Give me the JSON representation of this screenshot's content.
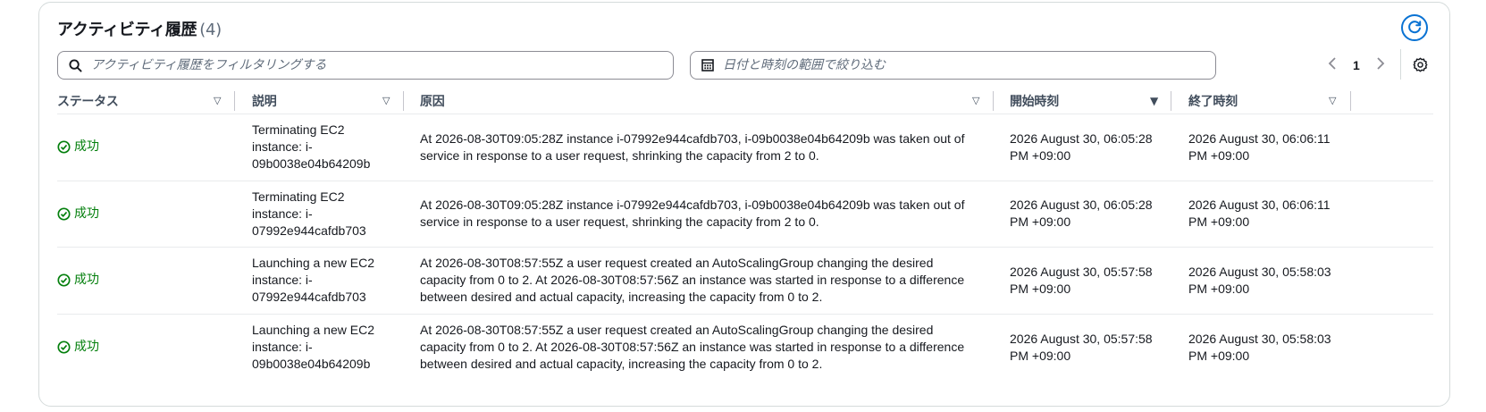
{
  "header": {
    "title": "アクティビティ履歴",
    "count": "(4)"
  },
  "filter": {
    "placeholder": "アクティビティ履歴をフィルタリングする",
    "icon": "search-icon"
  },
  "date_filter": {
    "placeholder": "日付と時刻の範囲で絞り込む",
    "icon": "calendar-icon"
  },
  "pagination": {
    "current_page": "1"
  },
  "colors": {
    "accent": "#0972d3",
    "success": "#037f0c",
    "border": "#8c8c94"
  },
  "columns": {
    "status": "ステータス",
    "description": "説明",
    "cause": "原因",
    "start": "開始時刻",
    "end": "終了時刻"
  },
  "rows": [
    {
      "status": "成功",
      "description": "Terminating EC2 instance: i-09b0038e04b64209b",
      "cause": "At 2026-08-30T09:05:28Z instance i-07992e944cafdb703, i-09b0038e04b64209b was taken out of service in response to a user request, shrinking the capacity from 2 to 0.",
      "start": "2026 August 30, 06:05:28 PM +09:00",
      "end": "2026 August 30, 06:06:11 PM +09:00"
    },
    {
      "status": "成功",
      "description": "Terminating EC2 instance: i-07992e944cafdb703",
      "cause": "At 2026-08-30T09:05:28Z instance i-07992e944cafdb703, i-09b0038e04b64209b was taken out of service in response to a user request, shrinking the capacity from 2 to 0.",
      "start": "2026 August 30, 06:05:28 PM +09:00",
      "end": "2026 August 30, 06:06:11 PM +09:00"
    },
    {
      "status": "成功",
      "description": "Launching a new EC2 instance: i-07992e944cafdb703",
      "cause": "At 2026-08-30T08:57:55Z a user request created an AutoScalingGroup changing the desired capacity from 0 to 2. At 2026-08-30T08:57:56Z an instance was started in response to a difference between desired and actual capacity, increasing the capacity from 0 to 2.",
      "start": "2026 August 30, 05:57:58 PM +09:00",
      "end": "2026 August 30, 05:58:03 PM +09:00"
    },
    {
      "status": "成功",
      "description": "Launching a new EC2 instance: i-09b0038e04b64209b",
      "cause": "At 2026-08-30T08:57:55Z a user request created an AutoScalingGroup changing the desired capacity from 0 to 2. At 2026-08-30T08:57:56Z an instance was started in response to a difference between desired and actual capacity, increasing the capacity from 0 to 2.",
      "start": "2026 August 30, 05:57:58 PM +09:00",
      "end": "2026 August 30, 05:58:03 PM +09:00"
    }
  ]
}
